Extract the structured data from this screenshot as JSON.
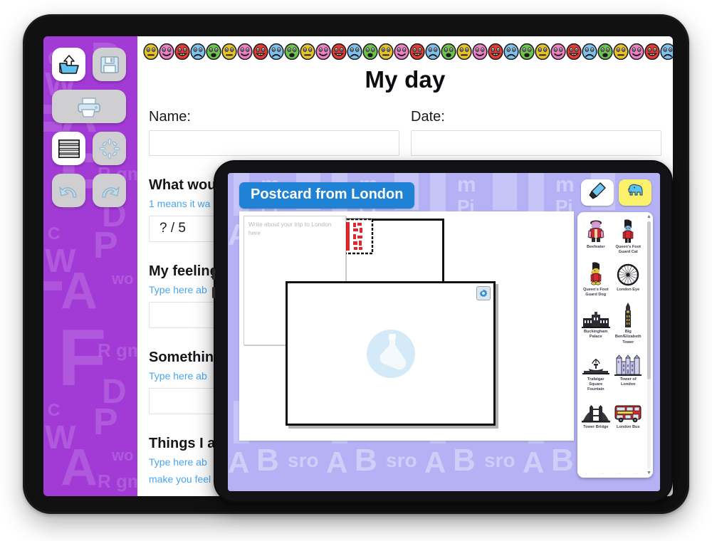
{
  "outer_app": {
    "toolbar": {
      "buttons": [
        {
          "name": "open-file",
          "icon": "open-folder-icon",
          "label": "Open",
          "active": true
        },
        {
          "name": "save-file",
          "icon": "floppy-disk-icon",
          "label": "Save",
          "active": false
        },
        {
          "name": "print",
          "icon": "printer-icon",
          "label": "Print",
          "active": false
        },
        {
          "name": "page-view",
          "icon": "lined-page-icon",
          "label": "Page view",
          "active": true
        },
        {
          "name": "clear",
          "icon": "sparkle-icon",
          "label": "Clear",
          "active": false
        },
        {
          "name": "undo",
          "icon": "undo-arrow-icon",
          "label": "Undo",
          "active": false
        },
        {
          "name": "redo",
          "icon": "redo-arrow-icon",
          "label": "Redo",
          "active": false
        }
      ]
    },
    "document": {
      "title": "My day",
      "name_label": "Name:",
      "name_value": "",
      "date_label": "Date:",
      "date_value": "",
      "sections": [
        {
          "question": "What woul",
          "hint": "1 means it wa",
          "value": "? / 5"
        },
        {
          "question": "My feeling",
          "hint": "Type here ab",
          "value": ""
        },
        {
          "question": "Something",
          "hint": "Type here ab",
          "value": ""
        },
        {
          "question": "Things I ar",
          "hint": "Type here ab",
          "hint2": "make you feel",
          "value": ""
        }
      ],
      "emoji_colors": [
        "#e6c229",
        "#ef7fc4",
        "#e23b32",
        "#7dc2ee",
        "#6dc24c"
      ]
    },
    "wallpaper_letters": [
      "C",
      "W",
      "A",
      "P",
      "B",
      "wo",
      "F",
      "R gm",
      "D",
      "P",
      "B"
    ]
  },
  "inner_app": {
    "title": "Postcard from London",
    "title_bg": "#1f82d4",
    "tools": [
      {
        "name": "pen-tool",
        "icon": "highlighter-pen-icon",
        "active": true
      },
      {
        "name": "symbols-tool",
        "icon": "elephant-icon",
        "active": false
      }
    ],
    "canvas": {
      "postcard_placeholder": "Write about your trip to London here",
      "stamp": {
        "icon": "postage-stamp-icon",
        "color": "#e8232a"
      },
      "image_box": {
        "placeholder_icon": "paint-bottle-icon",
        "settings_icon": "gear-icon"
      }
    },
    "palette": {
      "symbols": [
        {
          "label": "Beefeater",
          "icon": "beefeater-icon"
        },
        {
          "label": "Queen's Foot Guard Cat",
          "icon": "guard-cat-icon"
        },
        {
          "label": "Queen's Foot Guard Dog",
          "icon": "guard-dog-icon"
        },
        {
          "label": "London Eye",
          "icon": "london-eye-icon"
        },
        {
          "label": "Buckingham Palace",
          "icon": "buckingham-palace-icon"
        },
        {
          "label": "Big Ben/Elizabeth Tower",
          "icon": "big-ben-icon"
        },
        {
          "label": "Trafalgar Square Fountain",
          "icon": "trafalgar-fountain-icon"
        },
        {
          "label": "Tower of London",
          "icon": "tower-of-london-icon"
        },
        {
          "label": "Tower Bridge",
          "icon": "tower-bridge-icon"
        },
        {
          "label": "London Bus",
          "icon": "london-bus-icon"
        }
      ],
      "scroll_up": "▲",
      "scroll_down": "▼"
    },
    "wallpaper_letters": [
      "m",
      "Pi",
      "B",
      "sro",
      "A"
    ]
  }
}
